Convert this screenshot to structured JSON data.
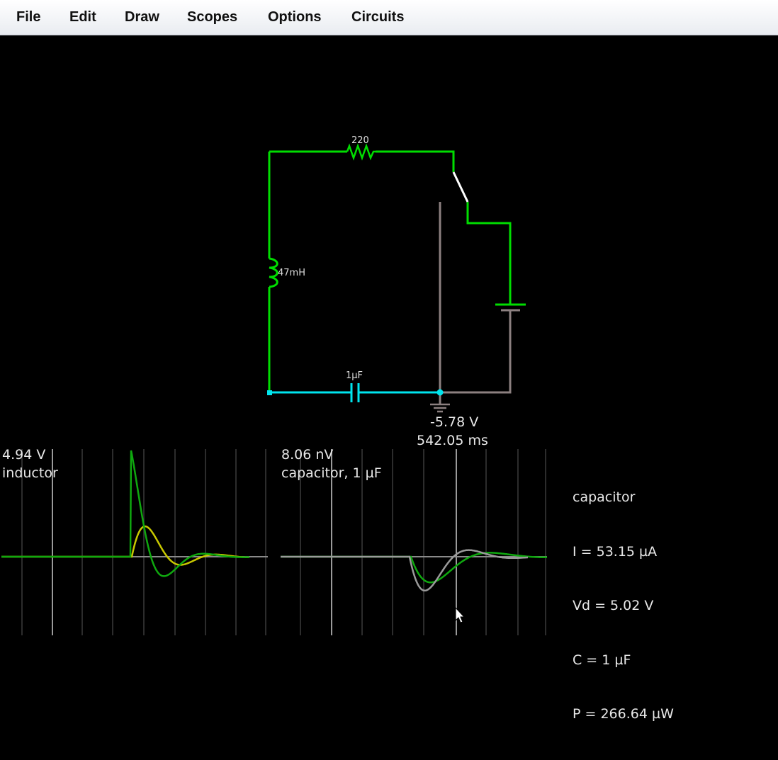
{
  "menu": {
    "items": [
      "File",
      "Edit",
      "Draw",
      "Scopes",
      "Options",
      "Circuits"
    ]
  },
  "circuit": {
    "resistor_label": "220",
    "inductor_label": "47mH",
    "capacitor_label": "1µF",
    "probe_voltage": "-5.78 V",
    "sim_time": "542.05 ms"
  },
  "scopes": {
    "inductor": {
      "value": "4.94 V",
      "name": "inductor"
    },
    "capacitor": {
      "value": "8.06 nV",
      "name": "capacitor, 1 µF"
    }
  },
  "info_panel": {
    "title": "capacitor",
    "current": "I = 53.15 µA",
    "voltage": "Vd = 5.02 V",
    "capacitance": "C = 1 µF",
    "power": "P = 266.64 µW"
  },
  "colors": {
    "wire_active": "#00dd00",
    "wire_capacitor": "#00e5ee",
    "wire_ground": "#8c8080",
    "switch_blade": "#ffffff",
    "trace_green": "#0fa80f",
    "trace_yellow": "#c8c800",
    "trace_gray": "#9a9a9a"
  },
  "icons": {
    "cursor": "mouse-pointer-icon",
    "ground": "ground-symbol-icon"
  }
}
